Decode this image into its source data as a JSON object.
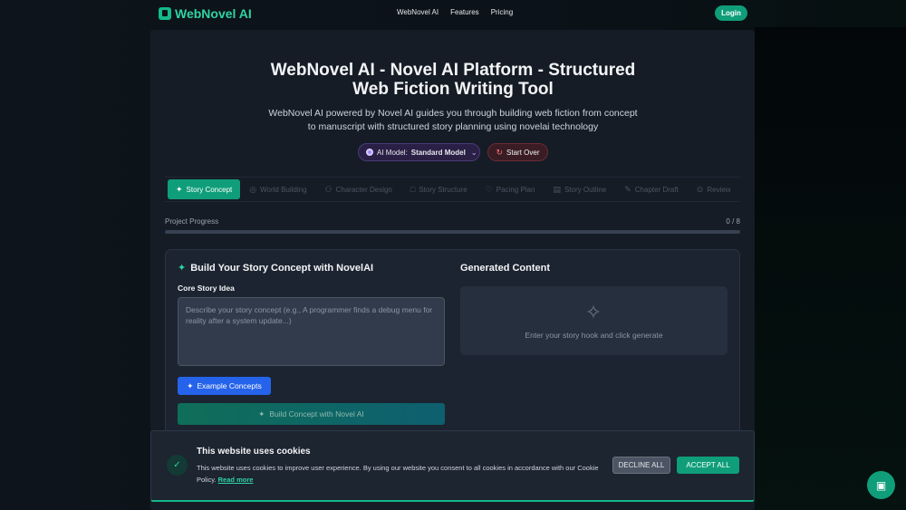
{
  "nav": {
    "logo_text": "WebNovel AI",
    "links": [
      "WebNovel AI",
      "Features",
      "Pricing"
    ],
    "login_label": "Login"
  },
  "hero": {
    "title_line1": "WebNovel AI - Novel AI Platform - Structured",
    "title_line2": "Web Fiction Writing Tool",
    "subtitle_line1": "WebNovel AI powered by Novel AI guides you through building web fiction from concept",
    "subtitle_line2": "to manuscript with structured story planning using novelai technology"
  },
  "controls": {
    "model_label": "AI Model:",
    "model_value": "Standard Model",
    "start_over_label": "Start Over"
  },
  "tabs": [
    {
      "label": "Story Concept",
      "icon": "sparkle-icon",
      "active": true
    },
    {
      "label": "World Building",
      "icon": "globe-icon",
      "active": false
    },
    {
      "label": "Character Design",
      "icon": "users-icon",
      "active": false
    },
    {
      "label": "Story Structure",
      "icon": "book-icon",
      "active": false
    },
    {
      "label": "Pacing Plan",
      "icon": "heart-icon",
      "active": false
    },
    {
      "label": "Story Outline",
      "icon": "document-icon",
      "active": false
    },
    {
      "label": "Chapter Draft",
      "icon": "pen-icon",
      "active": false
    },
    {
      "label": "Review",
      "icon": "check-circle-icon",
      "active": false
    }
  ],
  "progress": {
    "label": "Project Progress",
    "count_text": "0 / 8",
    "fraction": 0
  },
  "builder": {
    "title": "Build Your Story Concept with NovelAI",
    "field_label": "Core Story Idea",
    "placeholder": "Describe your story concept (e.g., A programmer finds a debug menu for reality after a system update...)",
    "example_label": "Example Concepts",
    "build_label": "Build Concept with Novel AI"
  },
  "generated": {
    "title": "Generated Content",
    "empty_message": "Enter your story hook and click generate"
  },
  "cookie": {
    "title": "This website uses cookies",
    "text": "This website uses cookies to improve user experience. By using our website you consent to all cookies in accordance with our Cookie Policy.",
    "read_more": "Read more",
    "decline_label": "DECLINE ALL",
    "accept_label": "ACCEPT ALL"
  },
  "colors": {
    "accent": "#0f9e79",
    "accent_text": "#2fd4a4",
    "blue_button": "#2563eb",
    "background": "#0b1117",
    "panel": "#151c25"
  }
}
